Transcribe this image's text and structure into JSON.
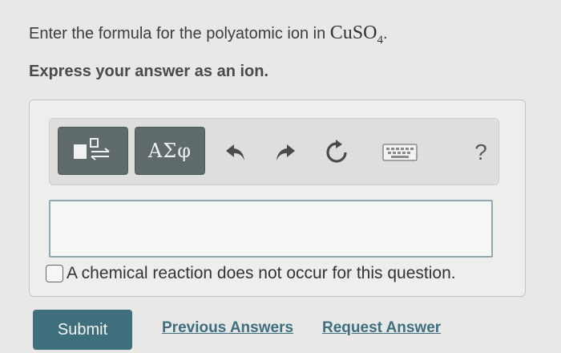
{
  "question": {
    "prompt_prefix": "Enter the formula for the polyatomic ion in",
    "compound_main": "CuSO",
    "compound_subscript": "4",
    "prompt_suffix": ".",
    "instruction": "Express your answer as an ion."
  },
  "toolbar": {
    "templates_icon": "templates-icon",
    "symbols_label": "ΑΣφ",
    "undo_icon": "undo-icon",
    "redo_icon": "redo-icon",
    "reset_icon": "reset-icon",
    "keyboard_icon": "keyboard-icon",
    "help_label": "?"
  },
  "answer": {
    "value": ""
  },
  "no_reaction": {
    "label": "A chemical reaction does not occur for this question.",
    "checked": false
  },
  "actions": {
    "submit_label": "Submit",
    "previous_answers_label": "Previous Answers",
    "request_answer_label": "Request Answer"
  },
  "colors": {
    "submit_bg": "#3f6f7c",
    "link": "#3d6f80",
    "toolbar_button": "#5f6a6a",
    "answer_border": "#8eaab0"
  }
}
